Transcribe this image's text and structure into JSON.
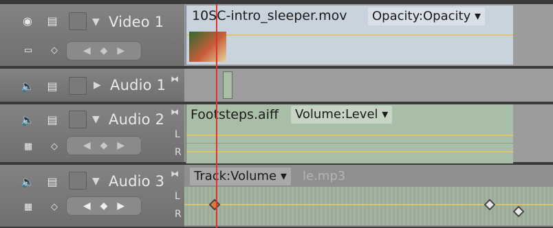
{
  "tracks": {
    "video1": {
      "name": "Video 1",
      "clip": "10SC-intro_sleeper.mov",
      "effect": "Opacity:Opacity"
    },
    "audio1": {
      "name": "Audio 1"
    },
    "audio2": {
      "name": "Audio 2",
      "clip": "Footsteps.aiff",
      "effect": "Volume:Level"
    },
    "audio3": {
      "name": "Audio 3",
      "effect": "Track:Volume",
      "clip_fragment": "le.mp3"
    }
  },
  "channels": {
    "left": "L",
    "right": "R"
  },
  "icons": {
    "eye": "eye-icon",
    "speaker": "speaker-icon",
    "collapse": "expand-collapse-icon",
    "keyframe": "keyframe-icon",
    "merge": "merge-icon"
  },
  "colors": {
    "playhead": "#e0322b",
    "video_bg": "#c9d3dd",
    "audio_bg": "#a9bea6",
    "rubber_band": "#e1c36a"
  }
}
